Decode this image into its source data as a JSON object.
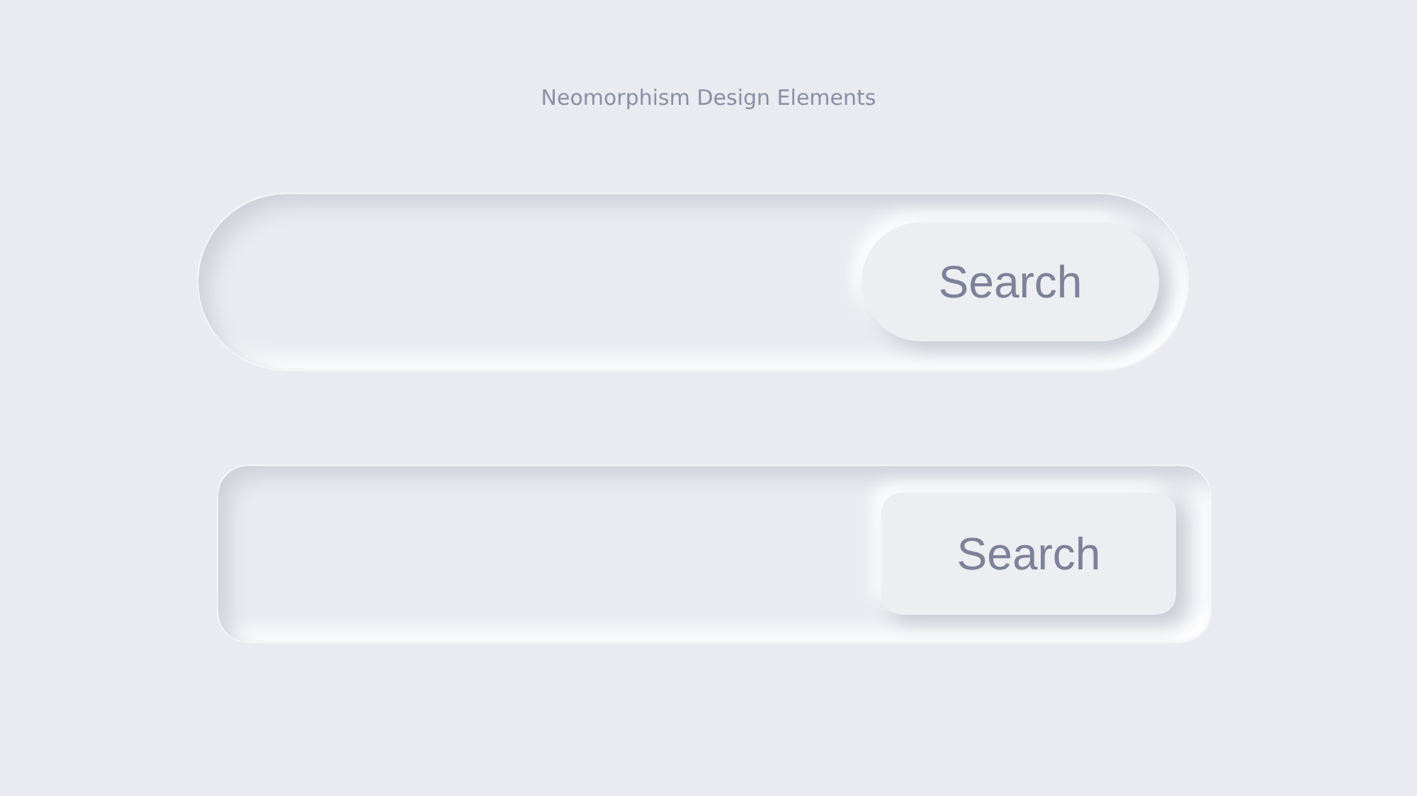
{
  "title": "Neomorphism Design Elements",
  "search_bars": [
    {
      "kind": "pill",
      "button": "Search"
    },
    {
      "kind": "rounded",
      "button": "Search"
    }
  ]
}
